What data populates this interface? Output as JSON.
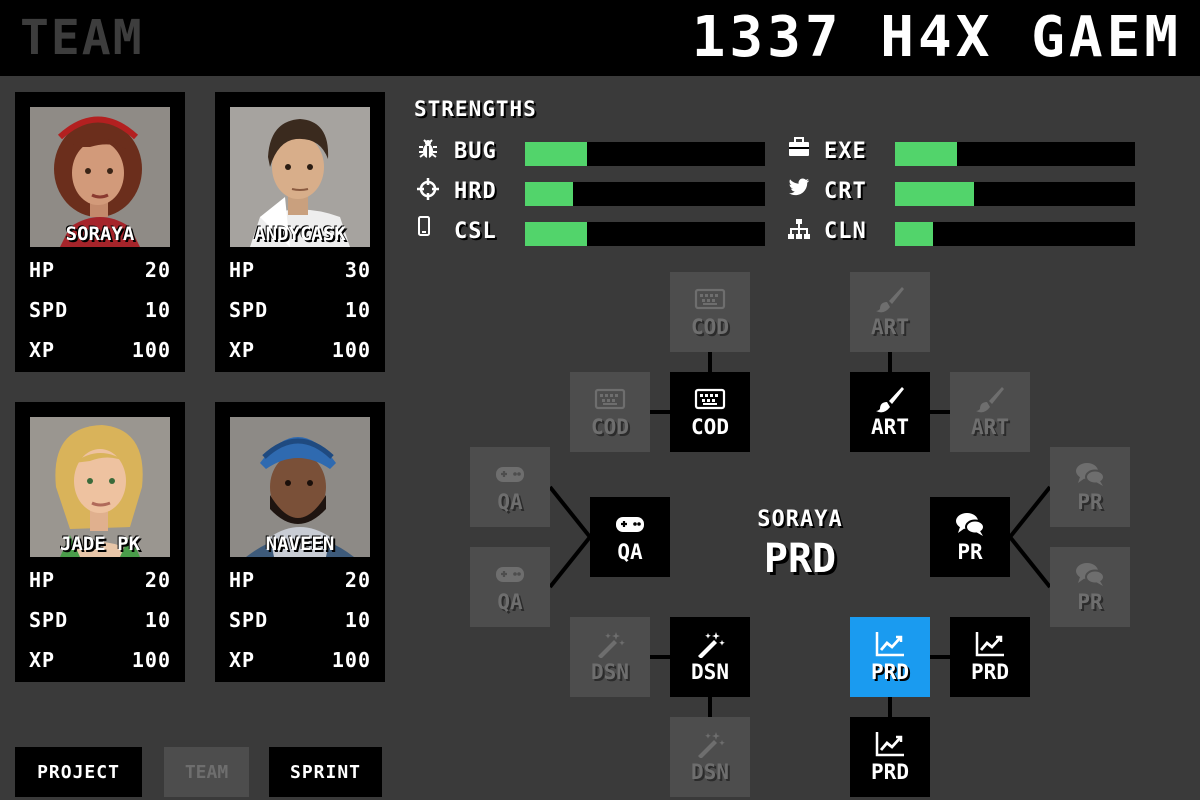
{
  "header": {
    "section_title": "TEAM",
    "game_title": "1337 H4X GAEM"
  },
  "team": [
    {
      "name": "SORAYA",
      "hp": "20",
      "spd": "10",
      "xp": "100"
    },
    {
      "name": "ANDYCASK",
      "hp": "30",
      "spd": "10",
      "xp": "100"
    },
    {
      "name": "JADE PK",
      "hp": "20",
      "spd": "10",
      "xp": "100"
    },
    {
      "name": "NAVEEN",
      "hp": "20",
      "spd": "10",
      "xp": "100"
    }
  ],
  "stat_labels": {
    "hp": "HP",
    "spd": "SPD",
    "xp": "XP"
  },
  "strengths": {
    "title": "STRENGTHS",
    "items": [
      {
        "label": "BUG",
        "icon": "bug-icon",
        "level": 0.26
      },
      {
        "label": "HRD",
        "icon": "crosshair-icon",
        "level": 0.2
      },
      {
        "label": "CSL",
        "icon": "mobile-icon",
        "level": 0.26
      },
      {
        "label": "EXE",
        "icon": "briefcase-icon",
        "level": 0.26
      },
      {
        "label": "CRT",
        "icon": "twitter-icon",
        "level": 0.33
      },
      {
        "label": "CLN",
        "icon": "sitemap-icon",
        "level": 0.16
      }
    ]
  },
  "skill_tree": {
    "character": "SORAYA",
    "role": "PRD",
    "nodes": {
      "cod_top": "COD",
      "cod_left": "COD",
      "cod_main": "COD",
      "art_top": "ART",
      "art_right": "ART",
      "art_main": "ART",
      "qa_main": "QA",
      "qa_upper": "QA",
      "qa_lower": "QA",
      "pr_main": "PR",
      "pr_upper": "PR",
      "pr_lower": "PR",
      "dsn_main": "DSN",
      "dsn_left": "DSN",
      "dsn_bottom": "DSN",
      "prd_selected": "PRD",
      "prd_right": "PRD",
      "prd_bottom": "PRD"
    }
  },
  "nav": {
    "project": "PROJECT",
    "team": "TEAM",
    "sprint": "SPRINT"
  },
  "colors": {
    "bar_fill": "#52d46b",
    "selected_node": "#1a9bf0",
    "inactive_node": "#4d4d4d",
    "background": "#3a3a3a"
  }
}
